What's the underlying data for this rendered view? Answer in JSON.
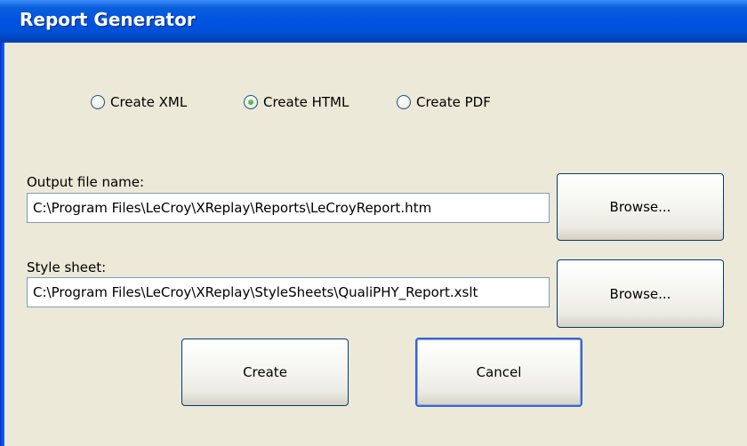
{
  "window": {
    "title": "Report Generator"
  },
  "format": {
    "options": [
      {
        "label": "Create XML",
        "selected": false
      },
      {
        "label": "Create HTML",
        "selected": true
      },
      {
        "label": "Create PDF",
        "selected": false
      }
    ]
  },
  "output": {
    "label": "Output file name:",
    "value": "C:\\Program Files\\LeCroy\\XReplay\\Reports\\LeCroyReport.htm",
    "browse_label": "Browse..."
  },
  "stylesheet": {
    "label": "Style sheet:",
    "value": "C:\\Program Files\\LeCroy\\XReplay\\StyleSheets\\QualiPHY_Report.xslt",
    "browse_label": "Browse..."
  },
  "actions": {
    "create_label": "Create",
    "cancel_label": "Cancel"
  }
}
